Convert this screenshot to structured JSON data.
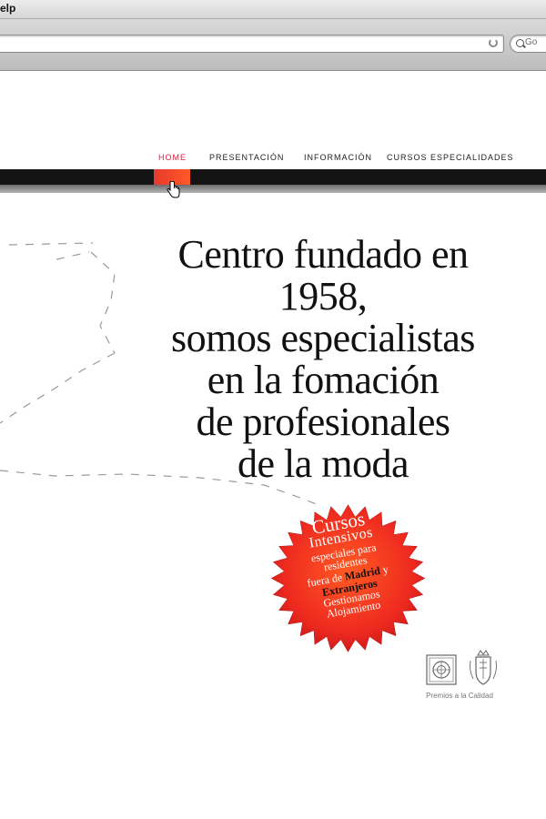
{
  "browser": {
    "menu_item": "elp",
    "search_placeholder": "Go"
  },
  "nav": {
    "items": [
      {
        "label": "HOME",
        "active": true
      },
      {
        "label": "PRESENTACIÓN",
        "active": false
      },
      {
        "label": "INFORMACIÓN",
        "active": false
      },
      {
        "label": "CURSOS ESPECIALIDADES",
        "active": false
      }
    ],
    "active_color": "#e3173a",
    "bar_color": "#141414",
    "active_tab_color": "#ff4a2a"
  },
  "headline": {
    "lines": [
      "Centro fundado en",
      "1958,",
      "somos especialistas",
      "en la fomación",
      "de profesionales",
      "de la moda"
    ]
  },
  "badge": {
    "line1": "Cursos",
    "line2": "Intensivos",
    "line3": "especiales para",
    "line4": "residentes",
    "line5_a": "fuera de ",
    "line5_b": "Madrid",
    "line5_c": " y",
    "line6": "Extranjeros",
    "line7": "Gestionamos",
    "line8": "Alojamiento",
    "color": "#ee2a1f"
  },
  "awards": {
    "label": "Premios a la Calidad",
    "icons": [
      "certificate-seal-icon",
      "crown-crest-icon"
    ]
  }
}
